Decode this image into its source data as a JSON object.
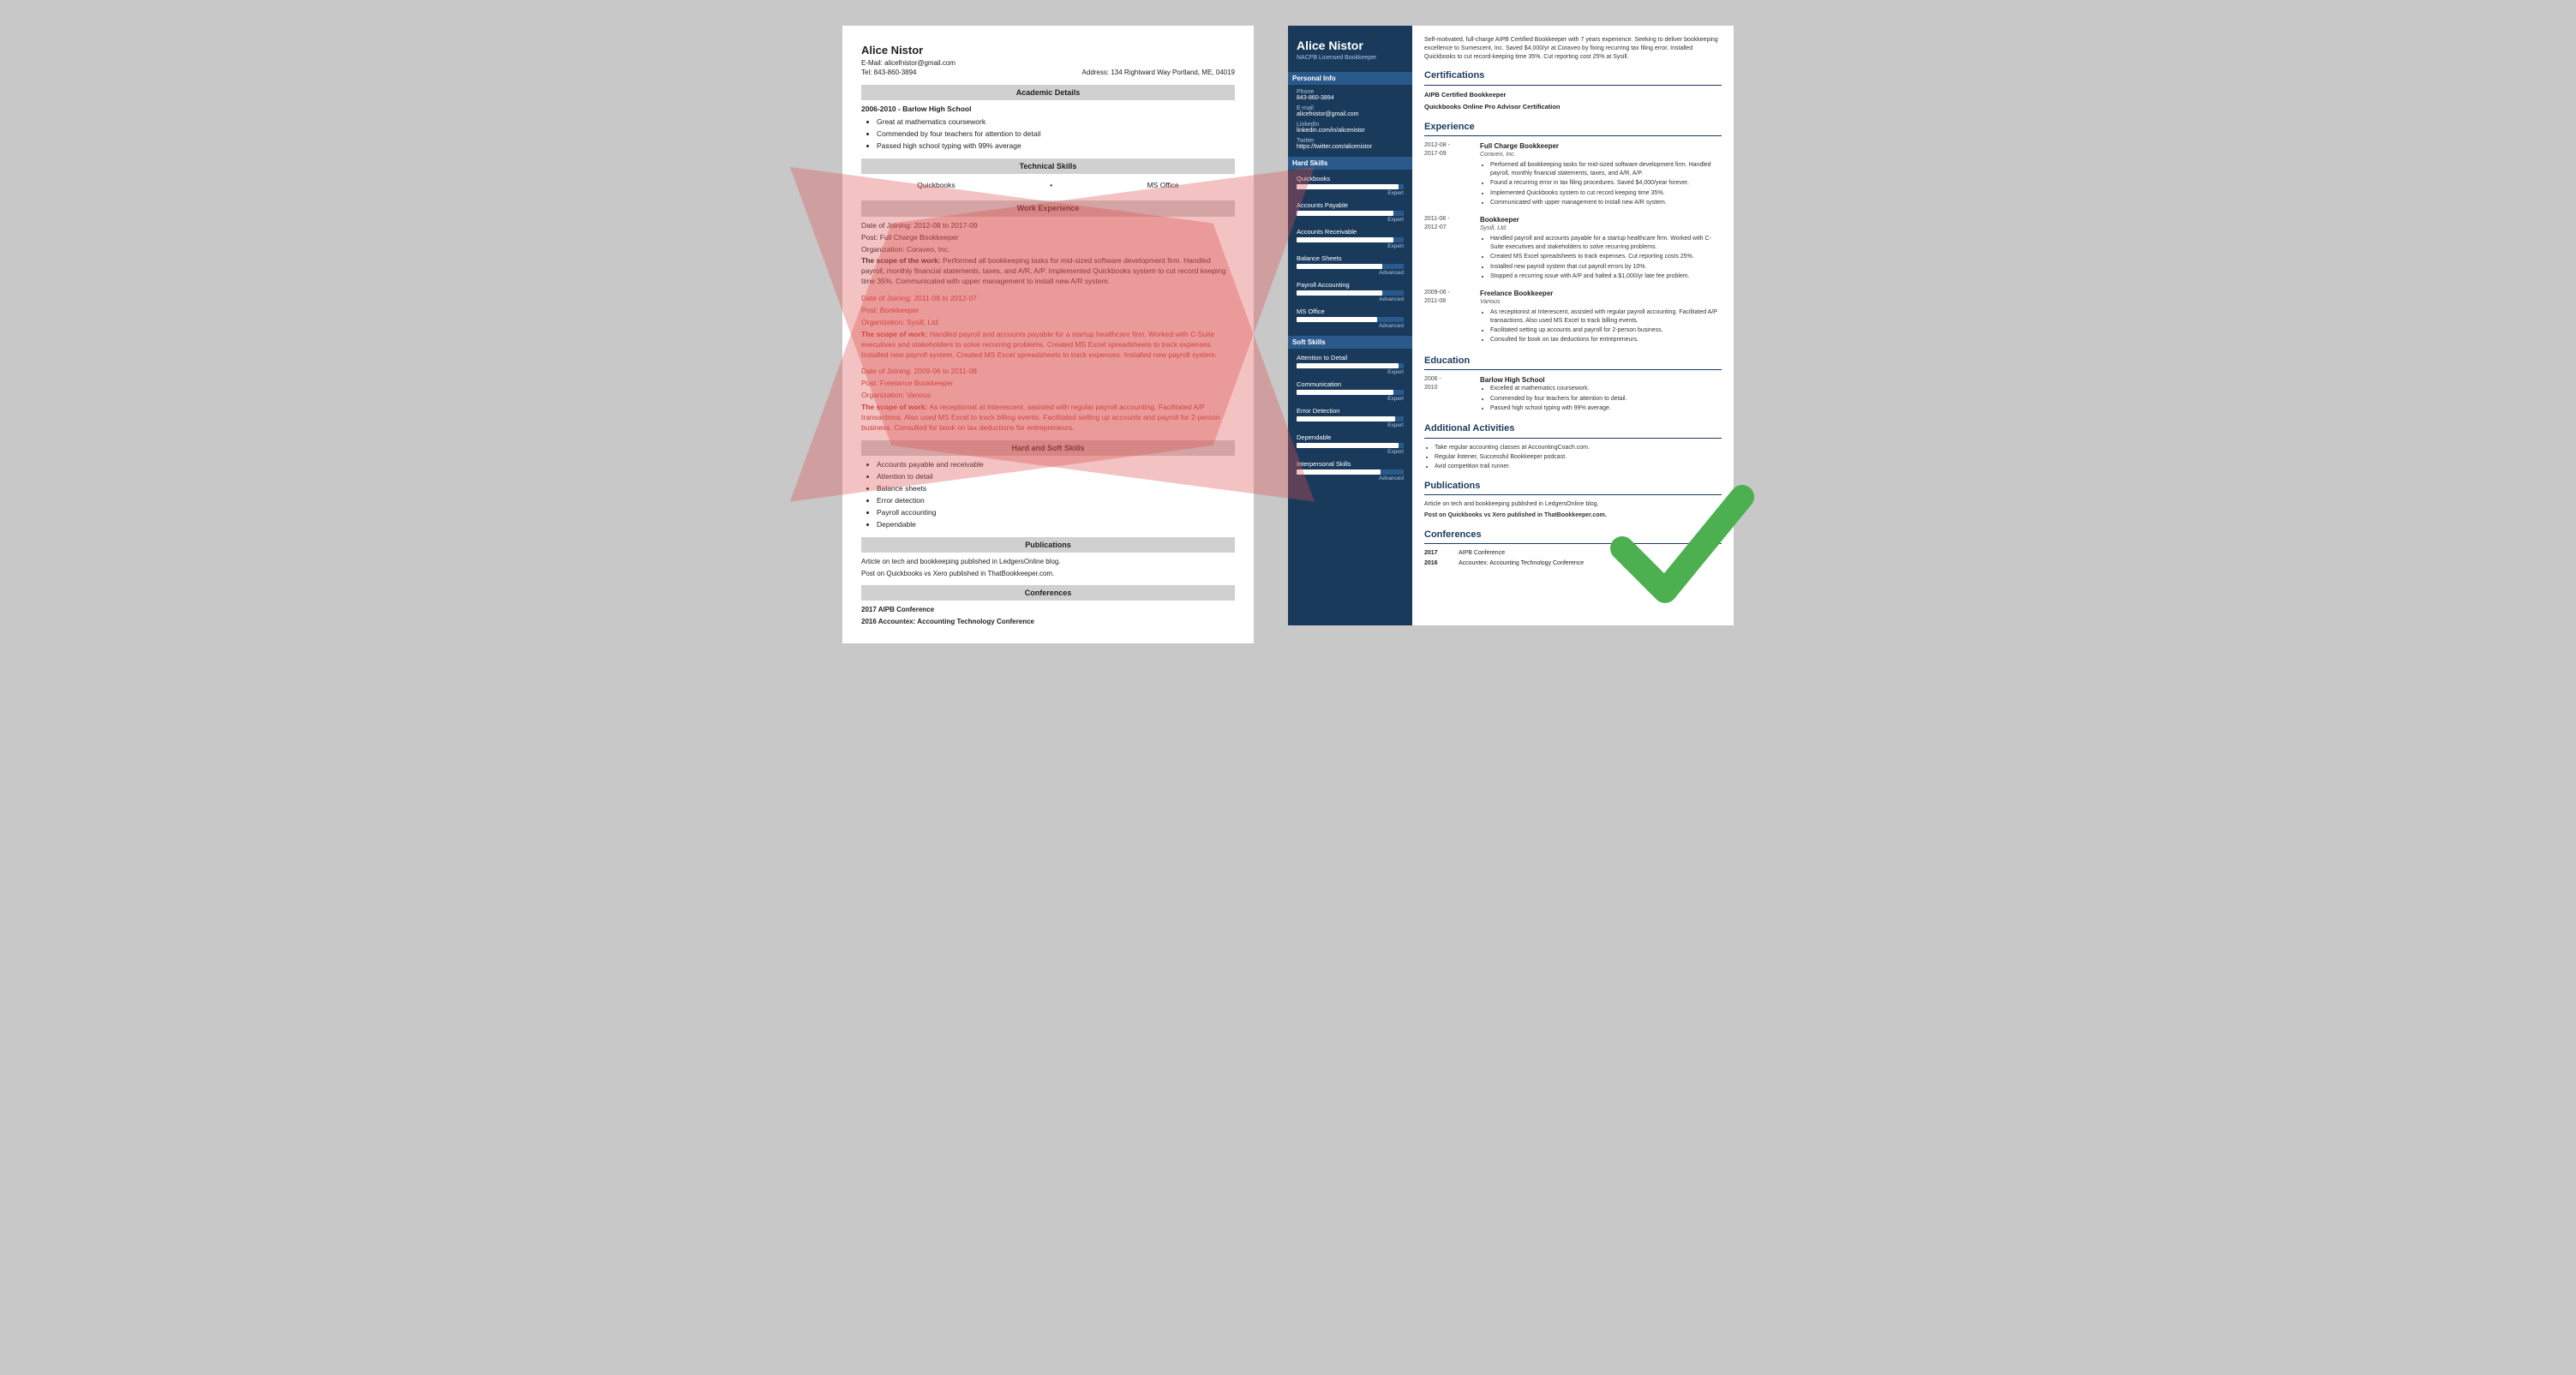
{
  "leftResume": {
    "name": "Alice Nistor",
    "email": "alicefnistor@gmail.com",
    "tel": "Tel: 843-860-3894",
    "address": "Address: 134 Rightward Way Portland, ME, 04019",
    "sections": {
      "academic": {
        "title": "Academic Details",
        "school": "2006-2010 - Barlow High School",
        "bullets": [
          "Great at mathematics coursework",
          "Commended by four teachers for attention to detail",
          "Passed high school typing with 99% average"
        ]
      },
      "technical": {
        "title": "Technical Skills",
        "skills": [
          "Quickbooks",
          "MS Office"
        ]
      },
      "work": {
        "title": "Work Experience",
        "jobs": [
          {
            "dateLabel": "Date of Joining:",
            "dates": "2012-08 to 2017-09",
            "postLabel": "Post:",
            "post": "Full Charge Bookkeeper",
            "orgLabel": "Organization:",
            "org": "Coraveo, Inc.",
            "scopeLabel": "The scope of the work:",
            "scope": "Performed all bookkeeping tasks for mid-sized software development firm. Handled payroll, monthly financial statements, taxes, and A/R, A/P. Implemented Quickbooks system to cut record keeping time 35%. Communicated with upper management to install new A/R system."
          },
          {
            "dateLabel": "Date of Joining:",
            "dates": "2011-08 to 2012-07",
            "postLabel": "Post:",
            "post": "Bookkeeper",
            "orgLabel": "Organization:",
            "org": "Sysill, Ltd.",
            "scopeLabel": "The scope of work:",
            "scope": "Handled payroll and accounts payable for a startup healthcare firm. Worked with C-Suite executives and stakeholders to solve recurring problems. Created MS Excel spreadsheets to track expenses. Installed new payroll system. Created MS Excel spreadsheets to track expenses. Installed new payroll system."
          },
          {
            "dateLabel": "Date of Joining:",
            "dates": "2009-06 to 2011-08",
            "postLabel": "Post:",
            "post": "Freelance Bookkeeper",
            "orgLabel": "Organization:",
            "org": "Various",
            "scopeLabel": "The scope of work:",
            "scope": "As receptionist at Interescent, assisted with regular payroll accounting. Facilitated A/P transactions. Also used MS Excel to track billing events. Facilitated setting up accounts and payroll for 2-person business. Consulted for book on tax deductions for entrepreneurs."
          }
        ]
      },
      "hardSoft": {
        "title": "Hard and Soft Skills",
        "skills": [
          "Accounts payable and receivable",
          "Attention to detail",
          "Balance sheets",
          "Error detection",
          "Payroll accounting",
          "Dependable"
        ]
      },
      "publications": {
        "title": "Publications",
        "items": [
          "Article on tech and bookkeeping published in LedgersOnline blog.",
          "Post on Quickbooks vs Xero published in ThatBookkeeper.com."
        ]
      },
      "conferences": {
        "title": "Conferences",
        "items": [
          {
            "year": "2017",
            "name": "AIPB Conference"
          },
          {
            "year": "2016",
            "name": "Accountex: Accounting Technology Conference"
          }
        ]
      }
    }
  },
  "rightResume": {
    "name": "Alice Nistor",
    "title": "NACPB Licensed Bookkeeper",
    "summary": "Self-motivated, full-charge AIPB Certified Bookkeeper with 7 years experience. Seeking to deliver bookkeeping excellence to Sumescent, Inc. Saved $4,000/yr at Coraveo by fixing recurring tax filing error. Installed Quickbooks to cut record-keeping time 35%. Cut reporting cost 25% at Sysill.",
    "sidebar": {
      "personalInfo": {
        "header": "Personal Info",
        "phone": {
          "label": "Phone",
          "value": "843-860-3894"
        },
        "email": {
          "label": "E-mail",
          "value": "alicefnistor@gmail.com"
        },
        "linkedin": {
          "label": "LinkedIn",
          "value": "linkedin.com/in/alicenistor"
        },
        "twitter": {
          "label": "Twitter",
          "value": "https://twitter.com/alicenistor"
        }
      },
      "hardSkills": {
        "header": "Hard Skills",
        "skills": [
          {
            "name": "Quickbooks",
            "level": "Expert",
            "pct": 95
          },
          {
            "name": "Accounts Payable",
            "level": "Expert",
            "pct": 90
          },
          {
            "name": "Accounts Receivable",
            "level": "Expert",
            "pct": 90
          },
          {
            "name": "Balance Sheets",
            "level": "Advanced",
            "pct": 80
          },
          {
            "name": "Payroll Accounting",
            "level": "Advanced",
            "pct": 80
          },
          {
            "name": "MS Office",
            "level": "Advanced",
            "pct": 75
          }
        ]
      },
      "softSkills": {
        "header": "Soft Skills",
        "skills": [
          {
            "name": "Attention to Detail",
            "level": "Expert",
            "pct": 95
          },
          {
            "name": "Communication",
            "level": "Expert",
            "pct": 90
          },
          {
            "name": "Error Detection",
            "level": "Expert",
            "pct": 92
          },
          {
            "name": "Dependable",
            "level": "Expert",
            "pct": 95
          },
          {
            "name": "Interpersonal Skills",
            "level": "Advanced",
            "pct": 78
          }
        ]
      }
    },
    "main": {
      "certifications": {
        "title": "Certifications",
        "items": [
          "AIPB Certified Bookkeeper",
          "Quickbooks Online Pro Advisor Certification"
        ]
      },
      "experience": {
        "title": "Experience",
        "jobs": [
          {
            "dates": "2012-08 -\n2017-09",
            "title": "Full Charge Bookkeeper",
            "company": "Coraveo, Inc.",
            "bullets": [
              "Performed all bookkeeping tasks for mid-sized software development firm. Handled payroll, monthly financial statements, taxes, and A/R, A/P.",
              "Found a recurring error in tax filing procedures. Saved $4,000/year forever.",
              "Implemented Quickbooks system to cut record keeping time 35%.",
              "Communicated with upper management to install new A/R system."
            ]
          },
          {
            "dates": "2011-08 -\n2012-07",
            "title": "Bookkeeper",
            "company": "Sysill, Ltd.",
            "bullets": [
              "Handled payroll and accounts payable for a startup healthcare firm. Worked with C-Suite executives and stakeholders to solve recurring problems.",
              "Created MS Excel spreadsheets to track expenses. Cut reporting costs 25%.",
              "Installed new payroll system that cut payroll errors by 10%.",
              "Stopped a recurring issue with A/P and halted a $1,000/yr late fee problem."
            ]
          },
          {
            "dates": "2009-06 -\n2011-08",
            "title": "Freelance Bookkeeper",
            "company": "Various",
            "bullets": [
              "As receptionist at Interescent, assisted with regular payroll accounting. Facilitated A/P transactions. Also used MS Excel to track billing events.",
              "Facilitated setting up accounts and payroll for 2-person business.",
              "Consulted for book on tax deductions for entrepreneurs."
            ]
          }
        ]
      },
      "education": {
        "title": "Education",
        "items": [
          {
            "dates": "2006 -\n2010",
            "school": "Barlow High School",
            "bullets": [
              "Excelled at mathematics coursework.",
              "Commended by four teachers for attention to detail.",
              "Passed high school typing with 99% average."
            ]
          }
        ]
      },
      "additional": {
        "title": "Additional Activities",
        "bullets": [
          "Take regular accounting classes at AccountingCoach.com.",
          "Regular listener, Successful Bookkeeper podcast.",
          "Avid competition trail runner."
        ]
      },
      "publications": {
        "title": "Publications",
        "items": [
          {
            "text": "Article on tech and bookkeeping published in LedgersOnline blog.",
            "bold": false
          },
          {
            "text": "Post on Quickbooks vs Xero published in ThatBookkeeper.com.",
            "bold": true
          }
        ]
      },
      "conferences": {
        "title": "Conferences",
        "items": [
          {
            "year": "2017",
            "name": "AIPB Conference"
          },
          {
            "year": "2016",
            "name": "Accountex: Accounting Technology Conference"
          }
        ]
      }
    }
  }
}
